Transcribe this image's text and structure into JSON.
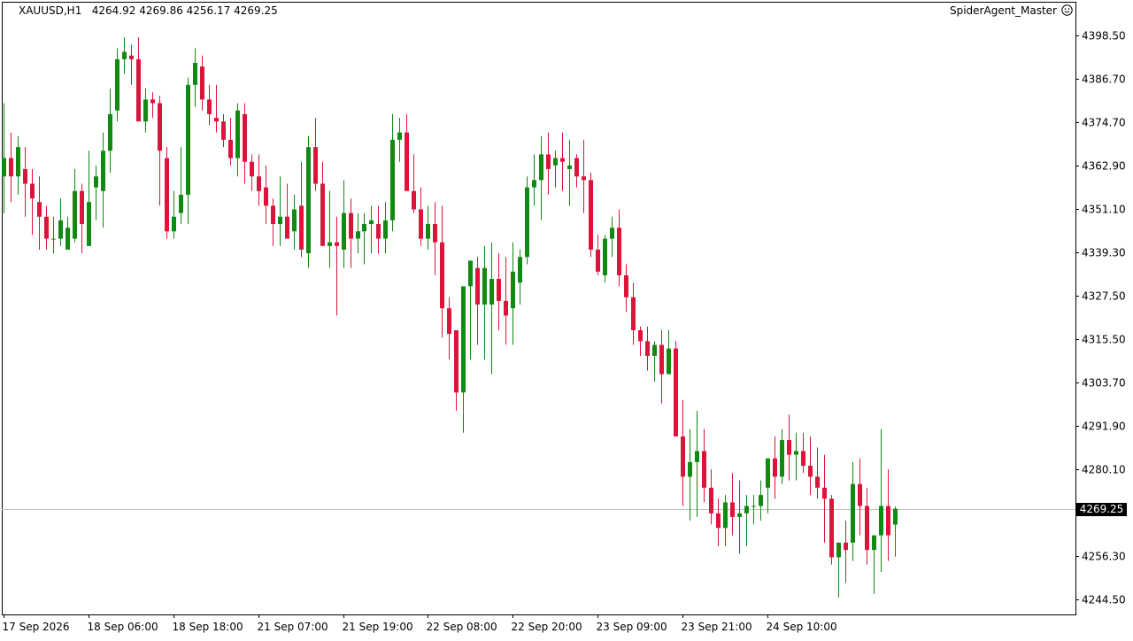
{
  "header": {
    "symbol": "XAUUSD,H1",
    "ohlc": "4264.92 4269.86 4256.17 4269.25",
    "account": "SpiderAgent_Master"
  },
  "current_price_label": "4269.25",
  "colors": {
    "bull": "#118a11",
    "bear": "#dc143c",
    "axis": "#000000",
    "price_line": "#c0c0c0"
  },
  "chart_data": {
    "type": "candlestick",
    "title": "XAUUSD,H1",
    "ylim": [
      4240.0,
      4405.0
    ],
    "y_ticks": [
      "4398.50",
      "4386.70",
      "4374.70",
      "4362.90",
      "4351.10",
      "4339.30",
      "4327.50",
      "4315.50",
      "4303.70",
      "4291.90",
      "4280.10",
      "4256.30",
      "4244.50"
    ],
    "x_ticks": [
      {
        "index": 0,
        "label": "17 Sep 2026"
      },
      {
        "index": 12,
        "label": "18 Sep 06:00"
      },
      {
        "index": 24,
        "label": "18 Sep 18:00"
      },
      {
        "index": 36,
        "label": "21 Sep 07:00"
      },
      {
        "index": 48,
        "label": "21 Sep 19:00"
      },
      {
        "index": 60,
        "label": "22 Sep 08:00"
      },
      {
        "index": 72,
        "label": "22 Sep 20:00"
      },
      {
        "index": 84,
        "label": "23 Sep 09:00"
      },
      {
        "index": 96,
        "label": "23 Sep 21:00"
      },
      {
        "index": 108,
        "label": "24 Sep 10:00"
      }
    ],
    "last_price": 4269.25,
    "candles": [
      [
        4360,
        4380,
        4350,
        4365
      ],
      [
        4365,
        4372,
        4353,
        4360
      ],
      [
        4360,
        4371,
        4355,
        4368
      ],
      [
        4362,
        4368,
        4349,
        4358
      ],
      [
        4358,
        4362,
        4344,
        4354
      ],
      [
        4353,
        4360,
        4340,
        4349
      ],
      [
        4349,
        4352,
        4340,
        4343
      ],
      [
        4343,
        4349,
        4339,
        4343
      ],
      [
        4343,
        4354,
        4341,
        4348
      ],
      [
        4340,
        4349,
        4340,
        4346
      ],
      [
        4343,
        4362,
        4342,
        4356
      ],
      [
        4356,
        4358,
        4339,
        4347
      ],
      [
        4341,
        4367,
        4344,
        4353
      ],
      [
        4357,
        4363,
        4348,
        4360
      ],
      [
        4356,
        4372,
        4346,
        4367
      ],
      [
        4367,
        4384,
        4361,
        4377
      ],
      [
        4378,
        4395,
        4375,
        4392
      ],
      [
        4392,
        4398,
        4388,
        4394
      ],
      [
        4393,
        4396,
        4385,
        4392
      ],
      [
        4392,
        4398,
        4377,
        4375
      ],
      [
        4375,
        4384,
        4372,
        4381
      ],
      [
        4381,
        4383,
        4376,
        4380
      ],
      [
        4380,
        4382,
        4352,
        4367
      ],
      [
        4365,
        4368,
        4343,
        4345
      ],
      [
        4345,
        4356,
        4343,
        4349
      ],
      [
        4350,
        4368,
        4347,
        4355
      ],
      [
        4355,
        4387,
        4347,
        4385
      ],
      [
        4385,
        4395,
        4379,
        4391
      ],
      [
        4390,
        4393,
        4378,
        4381
      ],
      [
        4381,
        4385,
        4374,
        4377
      ],
      [
        4376,
        4385,
        4372,
        4375
      ],
      [
        4375,
        4377,
        4368,
        4370
      ],
      [
        4370,
        4376,
        4363,
        4365
      ],
      [
        4365,
        4380,
        4360,
        4378
      ],
      [
        4377,
        4380,
        4358,
        4364
      ],
      [
        4364,
        4366,
        4356,
        4360
      ],
      [
        4360,
        4366,
        4352,
        4356
      ],
      [
        4357,
        4363,
        4347,
        4352
      ],
      [
        4352,
        4354,
        4341,
        4347
      ],
      [
        4347,
        4360,
        4341,
        4349
      ],
      [
        4349,
        4358,
        4345,
        4343
      ],
      [
        4345,
        4355,
        4340,
        4351
      ],
      [
        4352,
        4364,
        4338,
        4340
      ],
      [
        4339,
        4371,
        4335,
        4368
      ],
      [
        4368,
        4376,
        4356,
        4358
      ],
      [
        4358,
        4364,
        4343,
        4341
      ],
      [
        4341,
        4356,
        4335,
        4342
      ],
      [
        4342,
        4349,
        4322,
        4341
      ],
      [
        4340,
        4359,
        4335,
        4350
      ],
      [
        4350,
        4354,
        4335,
        4343
      ],
      [
        4343,
        4350,
        4339,
        4345
      ],
      [
        4345,
        4350,
        4336,
        4347
      ],
      [
        4347,
        4352,
        4339,
        4348
      ],
      [
        4347,
        4352,
        4339,
        4343
      ],
      [
        4343,
        4353,
        4339,
        4348
      ],
      [
        4348,
        4377,
        4345,
        4370
      ],
      [
        4370,
        4376,
        4364,
        4372
      ],
      [
        4372,
        4377,
        4358,
        4356
      ],
      [
        4356,
        4366,
        4350,
        4351
      ],
      [
        4351,
        4357,
        4341,
        4343
      ],
      [
        4343,
        4352,
        4340,
        4347
      ],
      [
        4347,
        4353,
        4333,
        4342
      ],
      [
        4342,
        4352,
        4316,
        4324
      ],
      [
        4324,
        4327,
        4310,
        4317
      ],
      [
        4318,
        4318,
        4296,
        4301
      ],
      [
        4301,
        4325,
        4290,
        4330
      ],
      [
        4330,
        4337,
        4310,
        4337
      ],
      [
        4335,
        4338,
        4314,
        4325
      ],
      [
        4325,
        4341,
        4310,
        4335
      ],
      [
        4325,
        4342,
        4306,
        4332
      ],
      [
        4332,
        4339,
        4318,
        4326
      ],
      [
        4326,
        4338,
        4314,
        4322
      ],
      [
        4324,
        4342,
        4314,
        4334
      ],
      [
        4331,
        4340,
        4325,
        4338
      ],
      [
        4338,
        4360,
        4336,
        4357
      ],
      [
        4357,
        4366,
        4352,
        4359
      ],
      [
        4359,
        4371,
        4348,
        4366
      ],
      [
        4366,
        4372,
        4355,
        4362
      ],
      [
        4363,
        4367,
        4357,
        4365
      ],
      [
        4365,
        4372,
        4356,
        4364
      ],
      [
        4362,
        4370,
        4352,
        4363
      ],
      [
        4365,
        4366,
        4357,
        4360
      ],
      [
        4360,
        4370,
        4350,
        4359
      ],
      [
        4359,
        4361,
        4338,
        4340
      ],
      [
        4340,
        4344,
        4333,
        4334
      ],
      [
        4333,
        4344,
        4331,
        4343
      ],
      [
        4343,
        4349,
        4338,
        4346
      ],
      [
        4346,
        4351,
        4330,
        4333
      ],
      [
        4333,
        4336,
        4323,
        4327
      ],
      [
        4327,
        4331,
        4314,
        4318
      ],
      [
        4318,
        4319,
        4311,
        4315
      ],
      [
        4315,
        4319,
        4307,
        4311
      ],
      [
        4311,
        4315,
        4304,
        4314
      ],
      [
        4314,
        4318,
        4298,
        4306
      ],
      [
        4306,
        4318,
        4306,
        4313
      ],
      [
        4313,
        4315,
        4296,
        4289
      ],
      [
        4289,
        4299,
        4270,
        4278
      ],
      [
        4278,
        4291,
        4266,
        4282
      ],
      [
        4282,
        4296,
        4267,
        4285
      ],
      [
        4285,
        4291,
        4271,
        4275
      ],
      [
        4275,
        4280,
        4265,
        4268
      ],
      [
        4268,
        4272,
        4259,
        4264
      ],
      [
        4264,
        4273,
        4259,
        4271
      ],
      [
        4271,
        4279,
        4262,
        4267
      ],
      [
        4267,
        4277,
        4257,
        4268
      ],
      [
        4268,
        4273,
        4259,
        4270
      ],
      [
        4270,
        4273,
        4265,
        4270
      ],
      [
        4270,
        4277,
        4266,
        4273
      ],
      [
        4275,
        4282,
        4268,
        4283
      ],
      [
        4283,
        4289,
        4272,
        4278
      ],
      [
        4278,
        4291,
        4276,
        4288
      ],
      [
        4288,
        4295,
        4277,
        4284
      ],
      [
        4284,
        4290,
        4277,
        4285
      ],
      [
        4285,
        4290,
        4279,
        4281
      ],
      [
        4281,
        4289,
        4273,
        4278
      ],
      [
        4278,
        4286,
        4272,
        4275
      ],
      [
        4275,
        4284,
        4260,
        4272
      ],
      [
        4272,
        4273,
        4254,
        4256
      ],
      [
        4256,
        4260,
        4245,
        4260
      ],
      [
        4260,
        4266,
        4249,
        4258
      ],
      [
        4260,
        4282,
        4255,
        4276
      ],
      [
        4276,
        4283,
        4262,
        4270
      ],
      [
        4270,
        4275,
        4254,
        4258
      ],
      [
        4258,
        4262,
        4246,
        4262
      ],
      [
        4262,
        4291,
        4252,
        4270
      ],
      [
        4270,
        4280,
        4255,
        4262
      ],
      [
        4264.92,
        4269.86,
        4256.17,
        4269.25
      ]
    ]
  }
}
